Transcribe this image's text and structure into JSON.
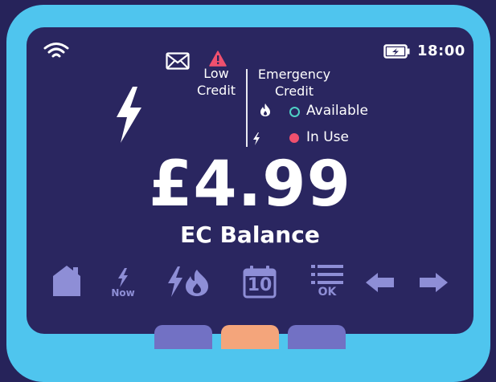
{
  "status": {
    "time": "18:00"
  },
  "alerts": {
    "low_credit_line1": "Low",
    "low_credit_line2": "Credit"
  },
  "emergency_credit": {
    "title_line1": "Emergency",
    "title_line2": "Credit",
    "available_label": "Available",
    "in_use_label": "In Use"
  },
  "balance": {
    "amount": "£4.99",
    "label": "EC Balance"
  },
  "nav": {
    "now_label": "Now",
    "calendar_day": "10",
    "ok_label": "OK"
  },
  "colors": {
    "bezel": "#4fc5ee",
    "screen": "#2a2660",
    "nav_icon": "#8e8ed6",
    "warning": "#f0506e",
    "available": "#4fd1c5",
    "tab_left": "#7271c4",
    "tab_center": "#f4a57b",
    "tab_right": "#7271c4"
  },
  "icons": [
    "wifi-icon",
    "battery-charging-icon",
    "envelope-icon",
    "warning-icon",
    "lightning-icon",
    "flame-icon",
    "home-icon",
    "arrow-left-icon",
    "arrow-right-icon",
    "calendar-icon",
    "menu-icon"
  ]
}
